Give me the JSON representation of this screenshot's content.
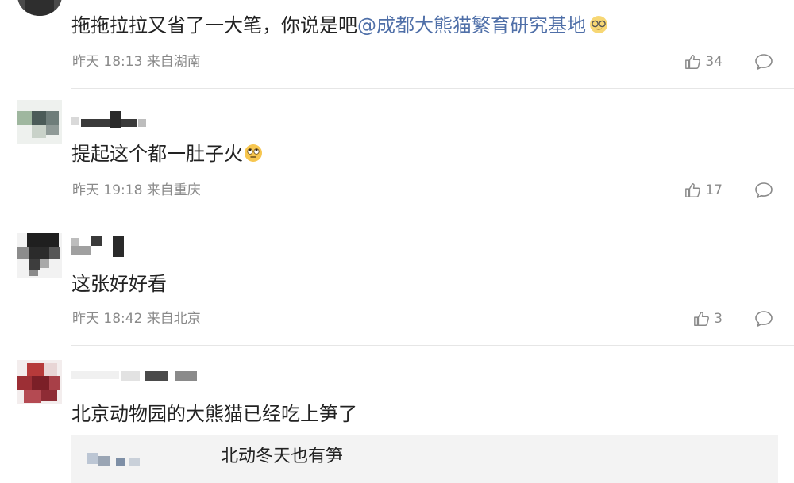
{
  "comments": [
    {
      "text_prefix": "拖拖拉拉又省了一大笔，你说是吧",
      "mention": "@成都大熊猫繁育研究基地",
      "emoji": "glasses-face-emoji",
      "meta": "昨天 18:13 来自湖南",
      "likes": "34"
    },
    {
      "text": "提起这个都一肚子火",
      "emoji": "eye-roll-emoji",
      "meta": "昨天 19:18 来自重庆",
      "likes": "17"
    },
    {
      "text": "这张好好看",
      "meta": "昨天 18:42 来自北京",
      "likes": "3"
    },
    {
      "text": "北京动物园的大熊猫已经吃上笋了",
      "sub_reply": "北动冬天也有笋"
    }
  ],
  "icons": {
    "like": "thumbs-up-icon",
    "reply": "comment-bubble-icon"
  },
  "colors": {
    "mention": "#4f6fa8",
    "meta": "#8a8a8a",
    "divider": "#e6e6e6"
  }
}
